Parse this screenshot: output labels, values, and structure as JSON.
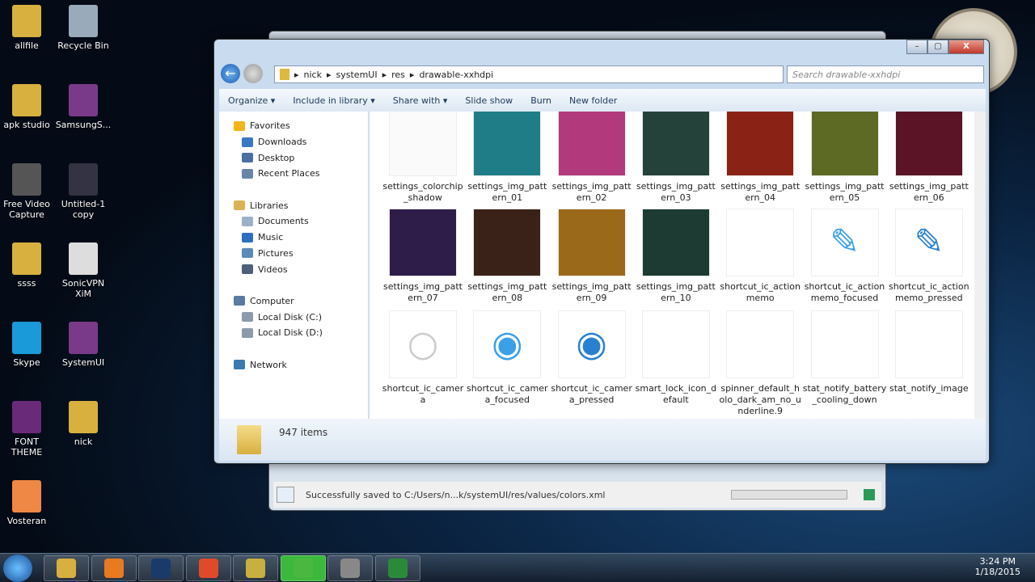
{
  "desktop": {
    "icons": [
      "allfile",
      "Recycle Bin",
      "apk studio",
      "SamsungS...",
      "Free Video Capture",
      "Untitled-1 copy",
      "ssss",
      "SonicVPN XiM",
      "Skype",
      "SystemUI",
      "FONT THEME",
      "nick",
      "Vosteran"
    ]
  },
  "back_window": {
    "status": "Successfully saved to C:/Users/n...k/systemUI/res/values/colors.xml"
  },
  "explorer": {
    "caption": {
      "min": "–",
      "max": "▢",
      "close": "X"
    },
    "breadcrumb": [
      "nick",
      "systemUI",
      "res",
      "drawable-xxhdpi"
    ],
    "search_placeholder": "Search drawable-xxhdpi",
    "toolbar": [
      "Organize ▾",
      "Include in library ▾",
      "Share with ▾",
      "Slide show",
      "Burn",
      "New folder"
    ],
    "sidebar": [
      {
        "label": "Favorites",
        "icon": "star-icon",
        "color": "#f2b418",
        "level": 0
      },
      {
        "label": "Downloads",
        "icon": "downloads-icon",
        "color": "#3a78c4",
        "level": 1
      },
      {
        "label": "Desktop",
        "icon": "desktop-icon",
        "color": "#4a6fa0",
        "level": 1
      },
      {
        "label": "Recent Places",
        "icon": "recent-places-icon",
        "color": "#6a86a6",
        "level": 1
      },
      {
        "label": "",
        "level": -1
      },
      {
        "label": "Libraries",
        "icon": "libraries-icon",
        "color": "#d8b455",
        "level": 0
      },
      {
        "label": "Documents",
        "icon": "documents-icon",
        "color": "#9cb0c8",
        "level": 1
      },
      {
        "label": "Music",
        "icon": "music-icon",
        "color": "#2d6fc0",
        "level": 1
      },
      {
        "label": "Pictures",
        "icon": "pictures-icon",
        "color": "#5c8ab8",
        "level": 1
      },
      {
        "label": "Videos",
        "icon": "videos-icon",
        "color": "#4d5f7a",
        "level": 1
      },
      {
        "label": "",
        "level": -1
      },
      {
        "label": "Computer",
        "icon": "computer-icon",
        "color": "#5a7aa0",
        "level": 0
      },
      {
        "label": "Local Disk (C:)",
        "icon": "disk-icon",
        "color": "#8a9aaa",
        "level": 1
      },
      {
        "label": "Local Disk (D:)",
        "icon": "disk-icon",
        "color": "#8a9aaa",
        "level": 1
      },
      {
        "label": "",
        "level": -1
      },
      {
        "label": "Network",
        "icon": "network-icon",
        "color": "#3a7ab0",
        "level": 0
      }
    ],
    "files": [
      {
        "name": "settings_colorchip_shadow",
        "color": "#fafafa"
      },
      {
        "name": "settings_img_pattern_01",
        "color": "#1e7d86"
      },
      {
        "name": "settings_img_pattern_02",
        "color": "#b23a7c"
      },
      {
        "name": "settings_img_pattern_03",
        "color": "#24423a"
      },
      {
        "name": "settings_img_pattern_04",
        "color": "#8a2216"
      },
      {
        "name": "settings_img_pattern_05",
        "color": "#5c6a24"
      },
      {
        "name": "settings_img_pattern_06",
        "color": "#5a1426"
      },
      {
        "name": "settings_img_pattern_07",
        "color": "#2e1d48"
      },
      {
        "name": "settings_img_pattern_08",
        "color": "#3a2218"
      },
      {
        "name": "settings_img_pattern_09",
        "color": "#9a6a1a"
      },
      {
        "name": "settings_img_pattern_10",
        "color": "#1d3b33"
      },
      {
        "name": "shortcut_ic_actionmemo",
        "color": "#ffffff",
        "glyph": ""
      },
      {
        "name": "shortcut_ic_actionmemo_focused",
        "color": "#ffffff",
        "glyph": "✎",
        "glyph_color": "#3aa0e8"
      },
      {
        "name": "shortcut_ic_actionmemo_pressed",
        "color": "#ffffff",
        "glyph": "✎",
        "glyph_color": "#2a80d0"
      },
      {
        "name": "shortcut_ic_camera",
        "color": "#ffffff",
        "glyph": "○",
        "glyph_color": "#ccc"
      },
      {
        "name": "shortcut_ic_camera_focused",
        "color": "#ffffff",
        "glyph": "◉",
        "glyph_color": "#3aa0e8"
      },
      {
        "name": "shortcut_ic_camera_pressed",
        "color": "#ffffff",
        "glyph": "◉",
        "glyph_color": "#2a80d0"
      },
      {
        "name": "smart_lock_icon_default",
        "color": "#ffffff"
      },
      {
        "name": "spinner_default_holo_dark_am_no_underline.9",
        "color": "#ffffff"
      },
      {
        "name": "stat_notify_battery_cooling_down",
        "color": "#ffffff"
      },
      {
        "name": "stat_notify_image",
        "color": "#ffffff"
      }
    ],
    "item_count": "947 items"
  },
  "taskbar": {
    "time": "3:24 PM",
    "date": "1/18/2015",
    "apps": [
      "Windows Explorer",
      "Media Player",
      "Photoshop",
      "Chrome",
      "Folder",
      "Internet Download Manager",
      "Video Tool",
      "Android"
    ]
  }
}
